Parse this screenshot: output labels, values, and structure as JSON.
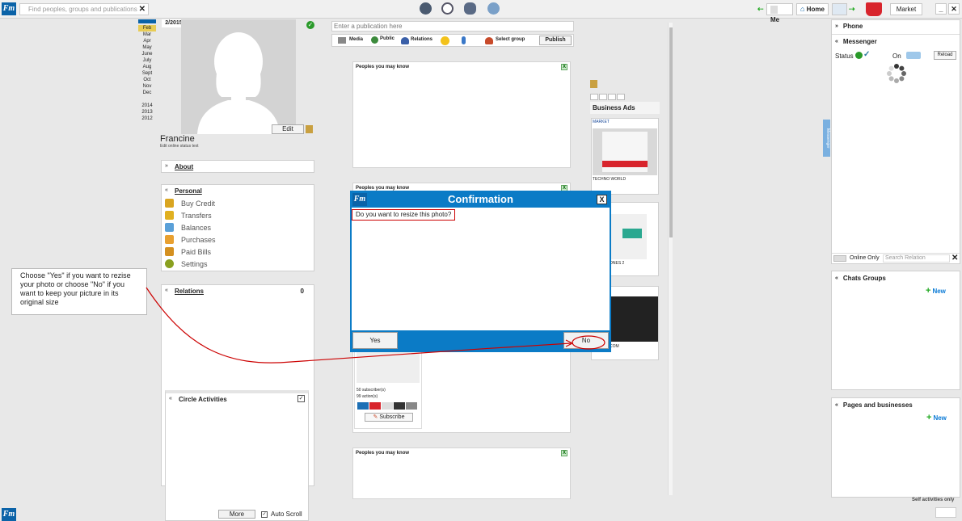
{
  "topbar": {
    "search_placeholder": "Find peoples, groups and publications",
    "me_label": "Me",
    "home_label": "Home",
    "market_label": "Market"
  },
  "logo_text": "Fm",
  "calendar": {
    "current": "2/2015",
    "months": [
      "Feb",
      "Mar",
      "Apr",
      "May",
      "June",
      "July",
      "Aug",
      "Sept",
      "Oct",
      "Nov",
      "Dec"
    ],
    "years": [
      "2014",
      "2013",
      "2012"
    ]
  },
  "profile": {
    "name": "Francine",
    "status_hint": "Edit online status text",
    "edit_label": "Edit"
  },
  "sections": {
    "about": "About",
    "personal": "Personal",
    "relations": "Relations",
    "relations_count": "0",
    "circle": "Circle Activities",
    "more_label": "More",
    "autoscroll_label": "Auto Scroll"
  },
  "personal_menu": [
    "Buy Credit",
    "Transfers",
    "Balances",
    "Purchases",
    "Paid Bills",
    "Settings"
  ],
  "personal_menu_colors": [
    "#d9a520",
    "#e0b020",
    "#5aa0d8",
    "#e8a030",
    "#d49020",
    "#8aa020"
  ],
  "publish": {
    "placeholder": "Enter a publication here",
    "media": "Media",
    "public": "Public",
    "relations": "Relations",
    "select_group": "Select group",
    "publish_button": "Publish"
  },
  "feed": {
    "card_title": "Peoples you may know",
    "close": "X",
    "subscribers": "50 subscriber(s)",
    "actions": "99 action(s)",
    "subscribe": "Subscribe"
  },
  "ads": {
    "title": "Business Ads",
    "market": "MARKET",
    "techno": "TECHNO WORLD",
    "phones": "ONES 2",
    "com": "COM"
  },
  "dialog": {
    "title": "Confirmation",
    "close": "X",
    "message": "Do you want to resize this photo?",
    "yes": "Yes",
    "no": "No"
  },
  "note": {
    "text": "Choose \"Yes\" if you want to rezise your photo or choose \"No\" if you want to keep your picture in its original size"
  },
  "right": {
    "phone": "Phone",
    "messenger": "Messenger",
    "status": "Status",
    "on": "On",
    "reload": "Reload",
    "online_only": "Online Only",
    "search_relation": "Search Relation",
    "chats_groups": "Chats Groups",
    "new": "New",
    "pages": "Pages and businesses",
    "self_activities": "Self activities only",
    "side_tab": "Messenger"
  },
  "colors": {
    "brand_blue": "#0b7bc6",
    "annotation_red": "#cc0000"
  }
}
